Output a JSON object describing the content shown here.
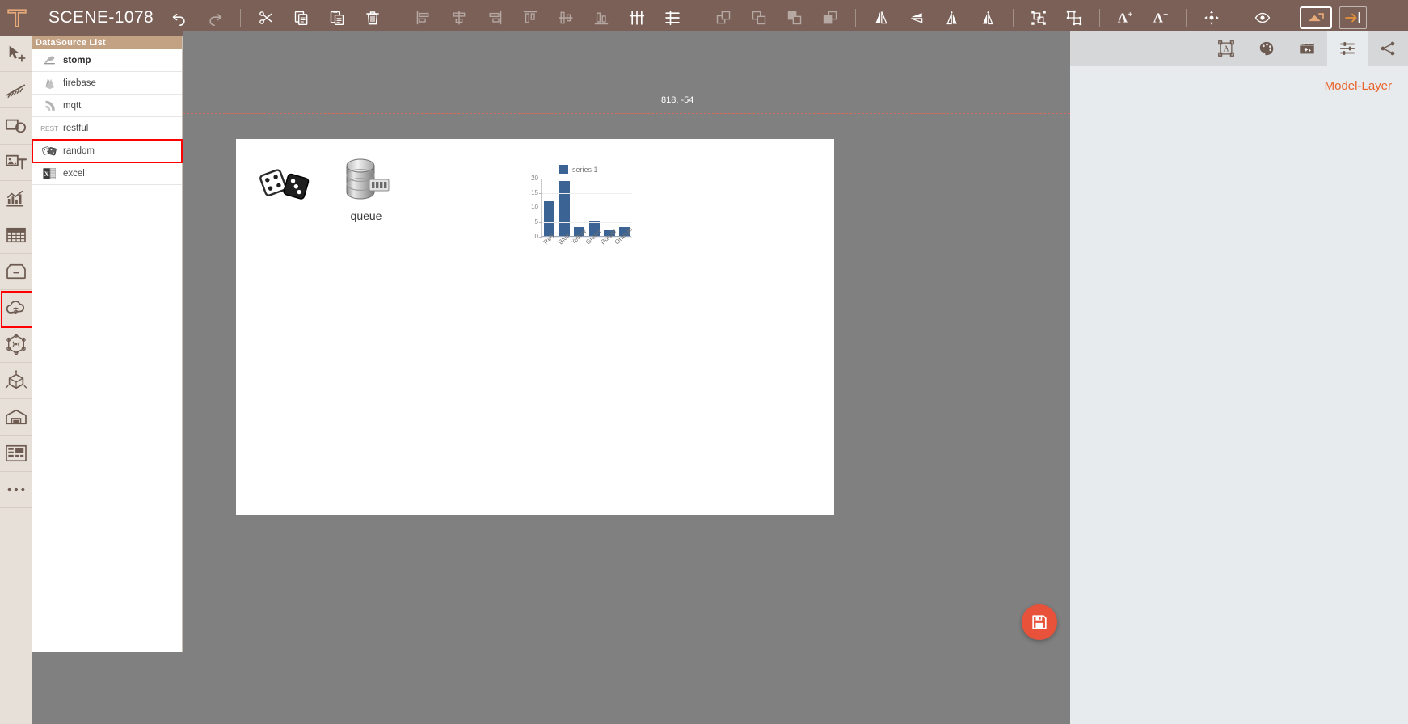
{
  "app": {
    "scene_title": "SCENE-1078",
    "logo_icon": "t-logo-icon"
  },
  "toolbar": {
    "buttons": [
      {
        "name": "undo-button",
        "icon": "undo-icon",
        "label": "Undo",
        "enabled": true
      },
      {
        "name": "redo-button",
        "icon": "redo-icon",
        "label": "Redo",
        "enabled": false
      },
      {
        "name": "cut-button",
        "icon": "scissors-icon",
        "label": "Cut",
        "enabled": true
      },
      {
        "name": "copy-button",
        "icon": "copy-icon",
        "label": "Copy",
        "enabled": true
      },
      {
        "name": "paste-button",
        "icon": "paste-icon",
        "label": "Paste",
        "enabled": true
      },
      {
        "name": "delete-button",
        "icon": "trash-icon",
        "label": "Delete",
        "enabled": true
      },
      {
        "name": "align-left-button",
        "icon": "align-left-icon",
        "label": "Align Left",
        "enabled": false
      },
      {
        "name": "align-center-h-button",
        "icon": "align-center-h-icon",
        "label": "Align Center",
        "enabled": false
      },
      {
        "name": "align-right-button",
        "icon": "align-right-icon",
        "label": "Align Right",
        "enabled": false
      },
      {
        "name": "align-top-button",
        "icon": "align-top-icon",
        "label": "Align Top",
        "enabled": false
      },
      {
        "name": "align-middle-button",
        "icon": "align-middle-icon",
        "label": "Align Middle",
        "enabled": false
      },
      {
        "name": "align-bottom-button",
        "icon": "align-bottom-icon",
        "label": "Align Bottom",
        "enabled": false
      },
      {
        "name": "distribute-horizontal-button",
        "icon": "distribute-horizontal-icon",
        "label": "Distribute Horizontally",
        "enabled": true
      },
      {
        "name": "distribute-vertical-button",
        "icon": "distribute-vertical-icon",
        "label": "Distribute Vertically",
        "enabled": true
      },
      {
        "name": "bring-to-front-button",
        "icon": "bring-to-front-icon",
        "label": "Bring to Front",
        "enabled": false
      },
      {
        "name": "bring-forward-button",
        "icon": "bring-forward-icon",
        "label": "Bring Forward",
        "enabled": false
      },
      {
        "name": "send-backward-button",
        "icon": "send-backward-icon",
        "label": "Send Backward",
        "enabled": false
      },
      {
        "name": "send-to-back-button",
        "icon": "send-to-back-icon",
        "label": "Send to Back",
        "enabled": false
      },
      {
        "name": "flip-horizontal-button",
        "icon": "flip-horizontal-icon",
        "label": "Flip Horizontal",
        "enabled": true
      },
      {
        "name": "flip-vertical-button",
        "icon": "flip-vertical-icon",
        "label": "Flip Vertical",
        "enabled": true
      },
      {
        "name": "rotate-left-button",
        "icon": "rotate-left-icon",
        "label": "Rotate Left",
        "enabled": true
      },
      {
        "name": "rotate-right-button",
        "icon": "rotate-right-icon",
        "label": "Rotate Right",
        "enabled": true
      },
      {
        "name": "group-button",
        "icon": "group-icon",
        "label": "Group",
        "enabled": true
      },
      {
        "name": "ungroup-button",
        "icon": "ungroup-icon",
        "label": "Ungroup",
        "enabled": true
      }
    ],
    "font_increase_label": "A",
    "font_increase_sup": "+",
    "font_decrease_label": "A",
    "font_decrease_sup": "−",
    "move_button": {
      "name": "move-button",
      "icon": "move-arrows-icon",
      "label": "Move"
    },
    "preview_button": {
      "name": "preview-button",
      "icon": "eye-icon",
      "label": "Preview"
    },
    "presentation_button": {
      "name": "presentation-button",
      "icon": "screen-icon",
      "label": "Presentation Mode"
    },
    "panel-toggle_button": {
      "name": "panel-toggle-button",
      "icon": "arrow-right-bar-icon",
      "label": "Toggle Panel"
    }
  },
  "left_rail": {
    "items": [
      {
        "name": "sidebar-item-select",
        "icon": "cursor-move-icon",
        "label": "Select",
        "selected": false
      },
      {
        "name": "sidebar-item-line",
        "icon": "dashed-line-icon",
        "label": "Line",
        "selected": false
      },
      {
        "name": "sidebar-item-shape",
        "icon": "shapes-icon",
        "label": "Shape",
        "selected": false
      },
      {
        "name": "sidebar-item-media",
        "icon": "image-text-icon",
        "label": "Media",
        "selected": false
      },
      {
        "name": "sidebar-item-chart",
        "icon": "chart-icon",
        "label": "Chart",
        "selected": false
      },
      {
        "name": "sidebar-item-table",
        "icon": "table-icon",
        "label": "Table",
        "selected": false
      },
      {
        "name": "sidebar-item-container",
        "icon": "box-icon",
        "label": "Container",
        "selected": false
      },
      {
        "name": "sidebar-item-datasource",
        "icon": "cloud-signal-icon",
        "label": "DataSource",
        "selected": true
      },
      {
        "name": "sidebar-item-network",
        "icon": "network-signal-icon",
        "label": "Network",
        "selected": false
      },
      {
        "name": "sidebar-item-3d",
        "icon": "cube-3d-icon",
        "label": "3D",
        "selected": false
      },
      {
        "name": "sidebar-item-warehouse",
        "icon": "warehouse-icon",
        "label": "Warehouse",
        "selected": false
      },
      {
        "name": "sidebar-item-layout",
        "icon": "layout-panels-icon",
        "label": "Layout",
        "selected": false
      },
      {
        "name": "sidebar-item-more",
        "icon": "ellipsis-icon",
        "label": "More",
        "selected": false
      }
    ]
  },
  "datasource_panel": {
    "header": "DataSource List",
    "items": [
      {
        "name": "datasource-item-stomp",
        "label": "stomp",
        "icon": "stomp-icon",
        "selected": false
      },
      {
        "name": "datasource-item-firebase",
        "label": "firebase",
        "icon": "firebase-icon",
        "selected": false
      },
      {
        "name": "datasource-item-mqtt",
        "label": "mqtt",
        "icon": "mqtt-icon",
        "selected": false
      },
      {
        "name": "datasource-item-restful",
        "label": "restful",
        "icon": "rest-icon",
        "icon_text": "REST",
        "selected": false
      },
      {
        "name": "datasource-item-random",
        "label": "random",
        "icon": "dice-icon",
        "selected": true
      },
      {
        "name": "datasource-item-excel",
        "label": "excel",
        "icon": "excel-icon",
        "selected": false
      }
    ]
  },
  "canvas": {
    "coordinates": "818, -54",
    "objects": {
      "dice": {
        "name": "dice-object",
        "icon": "dice-icon"
      },
      "queue": {
        "name": "queue-object",
        "icon": "database-icon",
        "label": "queue"
      }
    }
  },
  "chart_data": {
    "type": "bar",
    "title": "",
    "categories": [
      "Red",
      "Blue",
      "Yellow",
      "Green",
      "Purple",
      "Orange"
    ],
    "series": [
      {
        "name": "series 1",
        "values": [
          12,
          19,
          3,
          5,
          2,
          3
        ]
      }
    ],
    "legend": [
      "series 1"
    ],
    "legend_position": "top",
    "yticks": [
      0,
      5,
      10,
      15,
      20
    ],
    "ylim": [
      0,
      20
    ],
    "xlabel": "",
    "ylabel": "",
    "grid": true,
    "series_color": "#3b6494"
  },
  "right_panel": {
    "tabs": [
      {
        "name": "tab-text",
        "icon": "text-frame-icon",
        "label": "Text",
        "active": false
      },
      {
        "name": "tab-style",
        "icon": "palette-icon",
        "label": "Style",
        "active": false
      },
      {
        "name": "tab-animation",
        "icon": "clapper-icon",
        "label": "Animation",
        "active": false
      },
      {
        "name": "tab-properties",
        "icon": "sliders-icon",
        "label": "Properties",
        "active": true
      },
      {
        "name": "tab-share",
        "icon": "share-icon",
        "label": "Share",
        "active": false
      }
    ],
    "model_layer_label": "Model-Layer"
  },
  "fab": {
    "name": "save-fab-button",
    "icon": "save-icon",
    "label": "Save",
    "color": "#e8513a"
  },
  "colors": {
    "topbar": "#7a6057",
    "rail": "#e6e0d8",
    "ds_header": "#c3a183",
    "canvas": "#808080",
    "accent_orange": "#e8622a",
    "highlight_red": "#ff0000",
    "chart_blue": "#3b6494"
  }
}
